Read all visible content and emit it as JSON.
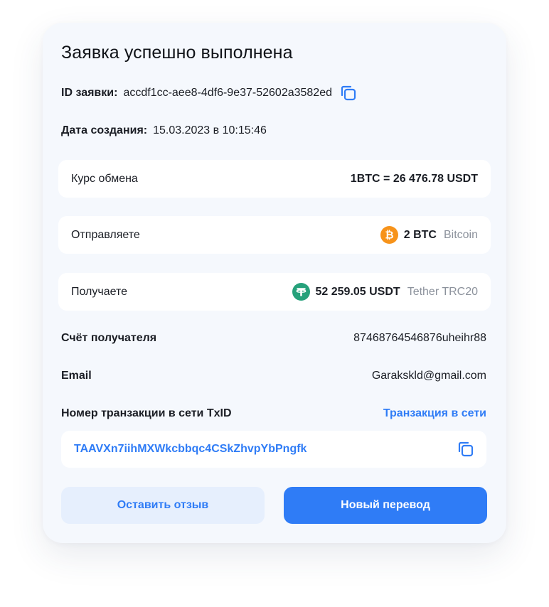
{
  "title": "Заявка успешно выполнена",
  "order": {
    "id_label": "ID заявки:",
    "id_value": "accdf1cc-aee8-4df6-9e37-52602a3582ed",
    "date_label": "Дата создания:",
    "date_value": "15.03.2023 в 10:15:46"
  },
  "rate": {
    "label": "Курс обмена",
    "value": "1BTC = 26 476.78 USDT"
  },
  "send": {
    "label": "Отправляете",
    "amount": "2 BTC",
    "currency": "Bitcoin",
    "icon": "bitcoin-icon",
    "color": "#f7931a"
  },
  "receive": {
    "label": "Получаете",
    "amount": "52 259.05 USDT",
    "currency": "Tether TRC20",
    "icon": "tether-icon",
    "color": "#26a17b"
  },
  "account": {
    "label": "Счёт получателя",
    "value": "87468764546876uheihr88"
  },
  "email": {
    "label": "Email",
    "value": "Garakskld@gmail.com"
  },
  "tx": {
    "label": "Номер транзакции в сети TxID",
    "link": "Транзакция в сети",
    "id": "TAAVXn7iihMXWkcbbqc4CSkZhvpYbPngfk"
  },
  "buttons": {
    "review": "Оставить отзыв",
    "new_transfer": "Новый перевод"
  },
  "colors": {
    "accent": "#2f7cf6",
    "card_bg": "#f5f8fd",
    "muted": "#8c929c"
  }
}
